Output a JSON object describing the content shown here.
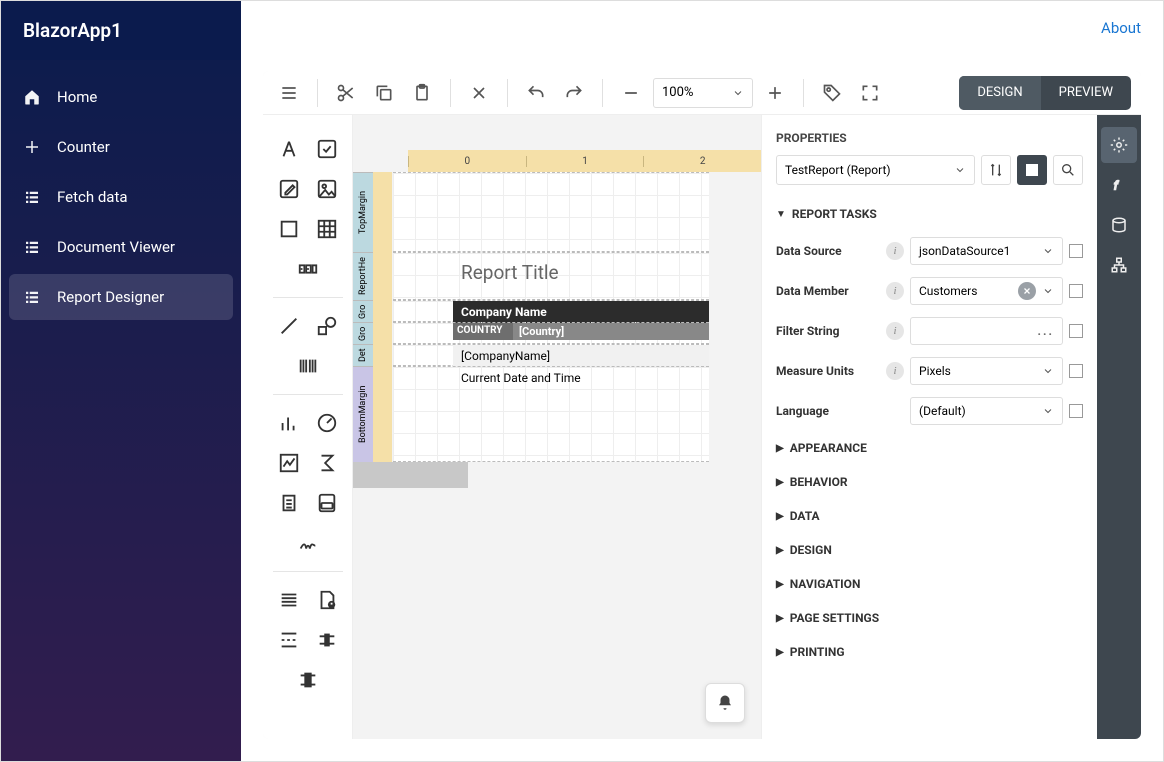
{
  "app": {
    "title": "BlazorApp1",
    "about": "About"
  },
  "sidebar": {
    "items": [
      {
        "label": "Home",
        "name": "sidebar-item-home",
        "icon": "home-icon"
      },
      {
        "label": "Counter",
        "name": "sidebar-item-counter",
        "icon": "plus-icon"
      },
      {
        "label": "Fetch data",
        "name": "sidebar-item-fetch",
        "icon": "list-icon"
      },
      {
        "label": "Document Viewer",
        "name": "sidebar-item-docviewer",
        "icon": "list-icon"
      },
      {
        "label": "Report Designer",
        "name": "sidebar-item-reportdesigner",
        "icon": "list-icon"
      }
    ],
    "activeIndex": 4
  },
  "toolbar": {
    "zoom": "100%",
    "design": "DESIGN",
    "preview": "PREVIEW",
    "activeSegment": "design"
  },
  "ruler": {
    "ticks": [
      "0",
      "1",
      "2"
    ]
  },
  "designSurface": {
    "sections": [
      "TopMargin",
      "ReportHe",
      "Gro",
      "Gro",
      "Det",
      "BottomMargin"
    ],
    "title": "Report Title",
    "columnHeader": "Company Name",
    "groupHeader": {
      "left": "COUNTRY",
      "right": "[Country]"
    },
    "detail": "[CompanyName]",
    "pageFooter": "Current Date and Time"
  },
  "properties": {
    "title": "PROPERTIES",
    "selector": "TestReport (Report)",
    "task_section": "REPORT TASKS",
    "fields": {
      "dataSource": {
        "label": "Data Source",
        "value": "jsonDataSource1"
      },
      "dataMember": {
        "label": "Data Member",
        "value": "Customers"
      },
      "filterString": {
        "label": "Filter String",
        "value": ""
      },
      "measureUnits": {
        "label": "Measure Units",
        "value": "Pixels"
      },
      "language": {
        "label": "Language",
        "value": "(Default)"
      }
    },
    "categories": [
      "APPEARANCE",
      "BEHAVIOR",
      "DATA",
      "DESIGN",
      "NAVIGATION",
      "PAGE SETTINGS",
      "PRINTING"
    ]
  },
  "rightRail": {
    "items": [
      {
        "name": "properties-tab",
        "icon": "gear-icon",
        "active": true
      },
      {
        "name": "expressions-tab",
        "icon": "fx-icon"
      },
      {
        "name": "data-tab",
        "icon": "database-icon"
      },
      {
        "name": "explorer-tab",
        "icon": "tree-icon"
      }
    ]
  }
}
